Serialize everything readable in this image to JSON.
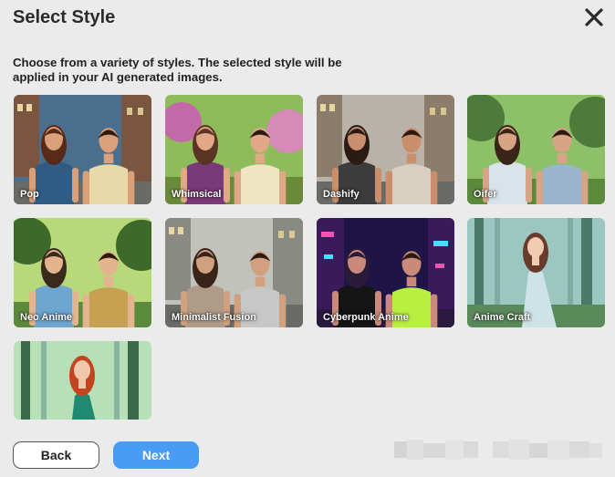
{
  "dialog": {
    "title": "Select Style",
    "close_icon": "close-icon",
    "description": "Choose from a variety of styles. The selected style will be applied in your AI generated images."
  },
  "styles": [
    {
      "label": "Pop",
      "theme": "city",
      "sky": "#4a6e8c",
      "bg": "#7a5540",
      "woman_hair": "#5a2a18",
      "woman_top": "#2f5b87",
      "man_top": "#e9d8a8",
      "skin": "#d9a07a"
    },
    {
      "label": "Whimsical",
      "theme": "garden",
      "sky": "#8fbc5a",
      "bg": "#c46aa8",
      "woman_hair": "#5a3524",
      "woman_top": "#7a3a78",
      "man_top": "#efe4c4",
      "skin": "#e0a886"
    },
    {
      "label": "Dashify",
      "theme": "street",
      "sky": "#b9b2a8",
      "bg": "#8c7c6c",
      "woman_hair": "#2a1b14",
      "woman_top": "#3c3c3c",
      "man_top": "#d8cfc0",
      "skin": "#c98f6c"
    },
    {
      "label": "Oifer",
      "theme": "park",
      "sky": "#8ec06a",
      "bg": "#4f7a3a",
      "woman_hair": "#3a2418",
      "woman_top": "#d9e3ea",
      "man_top": "#9bb6cc",
      "skin": "#d7a585"
    },
    {
      "label": "Neo Anime",
      "theme": "forest",
      "sky": "#b8d97a",
      "bg": "#3d6a2a",
      "woman_hair": "#3a2a1c",
      "woman_top": "#6fa6d0",
      "man_top": "#c7a052",
      "skin": "#e4b48e"
    },
    {
      "label": "Minimalist Fusion",
      "theme": "street",
      "sky": "#c2c2bc",
      "bg": "#8a8a84",
      "woman_hair": "#3a2418",
      "woman_top": "#b09b88",
      "man_top": "#c7c7c7",
      "skin": "#d1a07e"
    },
    {
      "label": "Cyberpunk Anime",
      "theme": "neon",
      "sky": "#1e1446",
      "bg": "#c43c9a",
      "woman_hair": "#2a1a3a",
      "woman_top": "#151515",
      "man_top": "#b8f040",
      "skin": "#c98a7a"
    },
    {
      "label": "Anime Craft",
      "theme": "forest_solo",
      "sky": "#9cc7c0",
      "bg": "#4a7a6a",
      "woman_hair": "#6a3a2a",
      "woman_top": "#cde3e6",
      "man_top": "",
      "skin": "#f0cdb2"
    },
    {
      "label": "",
      "theme": "forest_solo",
      "sky": "#b8e0b8",
      "bg": "#3a6a4a",
      "woman_hair": "#c2451e",
      "woman_top": "#1f8a70",
      "man_top": "",
      "skin": "#f2c8ac"
    }
  ],
  "buttons": {
    "back_label": "Back",
    "next_label": "Next"
  },
  "colors": {
    "accent": "#4a9bf5",
    "background": "#ebebeb"
  }
}
